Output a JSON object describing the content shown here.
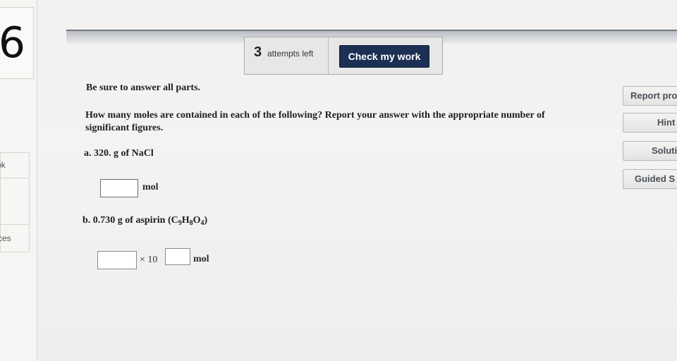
{
  "question_number": "6",
  "left_rail": {
    "ebook": "ok",
    "resources": "ces"
  },
  "header": {
    "attempts_count": "3",
    "attempts_label": "attempts left",
    "check_button": "Check my work"
  },
  "instructions": "Be sure to answer all parts.",
  "question": "How many moles are contained in each of the following? Report your answer with the appropriate number of significant figures.",
  "part_a": {
    "prefix": "a. 320. g of NaCl",
    "unit": "mol"
  },
  "part_b": {
    "prefix": "b. 0.730 g of aspirin (C",
    "sub1": "9",
    "h": "H",
    "sub2": "8",
    "o": "O",
    "sub3": "4",
    "suffix": ")",
    "times": "× 10",
    "unit": "mol"
  },
  "side_buttons": {
    "report": "Report pro",
    "hint": "Hint",
    "solution": "Soluti",
    "guided": "Guided S"
  }
}
